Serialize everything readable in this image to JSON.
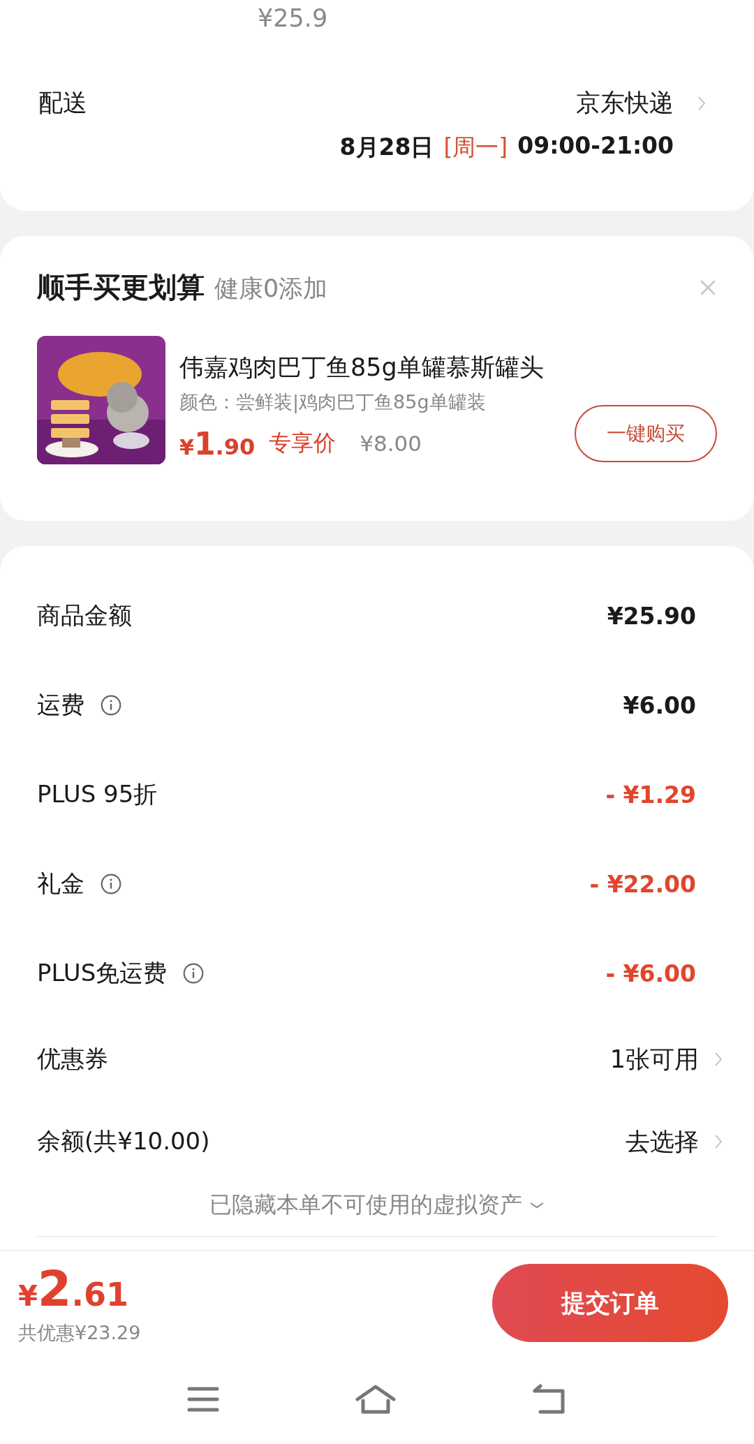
{
  "top_price": "¥25.9",
  "delivery": {
    "label": "配送",
    "carrier": "京东快递",
    "date": "8月28日",
    "weekday": "[周一]",
    "time": "09:00-21:00"
  },
  "upsell": {
    "title": "顺手买更划算",
    "subtitle": "健康0添加",
    "product": {
      "kind": "picture",
      "name": "伟嘉鸡肉巴丁鱼85g单罐慕斯罐头",
      "variant": "颜色：尝鲜装|鸡肉巴丁鱼85g单罐装",
      "price_symbol": "¥",
      "price_int": "1",
      "price_dec": ".90",
      "price_tag": "专享价",
      "original_price": "¥8.00",
      "button": "一键购买"
    }
  },
  "summary": {
    "rows": [
      {
        "label": "商品金额",
        "value": "¥25.90",
        "info": false,
        "kind": "amount"
      },
      {
        "label": "运费",
        "value": "¥6.00",
        "info": true,
        "kind": "amount"
      },
      {
        "label": "PLUS 95折",
        "value": "- ¥1.29",
        "info": false,
        "kind": "discount"
      },
      {
        "label": "礼金",
        "value": "- ¥22.00",
        "info": true,
        "kind": "discount"
      },
      {
        "label": "PLUS免运费",
        "value": "- ¥6.00",
        "info": true,
        "kind": "discount"
      },
      {
        "label": "优惠券",
        "value": "1张可用",
        "info": false,
        "kind": "link"
      },
      {
        "label": "余额(共¥10.00)",
        "value": "去选择",
        "info": false,
        "kind": "link"
      }
    ],
    "hidden_note": "已隐藏本单不可使用的虚拟资产"
  },
  "footer": {
    "total_symbol": "¥",
    "total_int": "2",
    "total_dec": ".61",
    "saved": "共优惠¥23.29",
    "submit": "提交订单"
  }
}
